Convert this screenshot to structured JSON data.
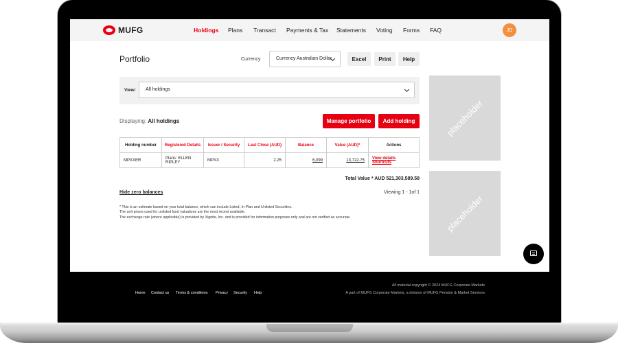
{
  "brand": {
    "logo_text": "MUFG",
    "accent_color": "#e60012"
  },
  "nav": {
    "items": [
      {
        "label": "Holdings",
        "active": true
      },
      {
        "label": "Plans"
      },
      {
        "label": "Transact"
      },
      {
        "label": "Payments & Tax"
      },
      {
        "label": "Statements"
      },
      {
        "label": "Voting"
      },
      {
        "label": "Forms"
      },
      {
        "label": "FAQ"
      }
    ],
    "avatar_initials": "JD"
  },
  "page": {
    "title": "Portfolio"
  },
  "currency": {
    "label": "Currency",
    "selected": "Currency Australian Dollar"
  },
  "toolbar": {
    "excel": "Excel",
    "print": "Print",
    "help": "Help"
  },
  "view": {
    "label": "View:",
    "selected": "All holdings"
  },
  "displaying": {
    "prefix": "Displaying:",
    "value": "All holdings"
  },
  "actions": {
    "manage": "Manage portfolio",
    "add": "Add holding"
  },
  "table": {
    "headers": [
      "Holding number",
      "Registered Details",
      "Issuer / Security",
      "Last Close (AUD)",
      "Balance",
      "Value (AUD)*",
      "Actions"
    ],
    "rows": [
      {
        "holding": "MPXXER",
        "details": "Plans: ELLEN RIPLEY",
        "issuer": "MPXX",
        "last_close": "2.25",
        "balance": "6,099",
        "value": "13,722.75",
        "view_link": "View details",
        "shortcuts_link": "Shortcuts"
      }
    ]
  },
  "total": "Total Value * AUD 521,303,589.58",
  "hide_zero": "Hide zero balances",
  "viewing": "Viewing 1 - 1of 1",
  "notes": [
    "* This is an estimate based on your total balance, which can include Listed, In-Plan and Unlisted Securities.",
    "The unit prices used for unlisted fund valuations are the most recent available.",
    "The exchange rate (where applicable) is provided by Xignite, Inc. and is provided for information purposes only and are not verified as accurate."
  ],
  "placeholders": [
    "placeholder",
    "placeholder"
  ],
  "footer": {
    "links": [
      "Home",
      "Contact us",
      "Terms & conditions",
      "Privacy",
      "Security",
      "Help"
    ],
    "copyright": "All material copyright © 2024 MUFG Corporate Markets",
    "division": "A part of MUFG Corporate Markets, a division of MUFG Pension & Market Services"
  },
  "icons": {
    "chat": "chat-icon",
    "chevron": "chevron-down-icon"
  }
}
